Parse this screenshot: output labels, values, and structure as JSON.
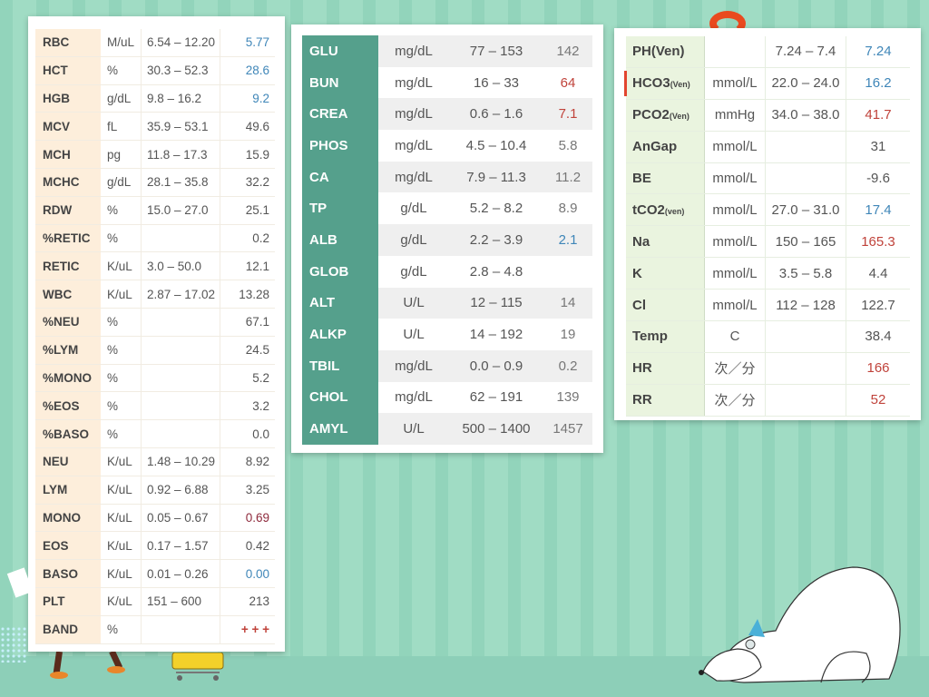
{
  "colors": {
    "red": "#c0433b",
    "blue": "#3f86b8",
    "maroon": "#8e2a3c"
  },
  "cbc": [
    {
      "name": "RBC",
      "unit": "M/uL",
      "range": "6.54 – 12.20",
      "value": "5.77",
      "flag": "blue"
    },
    {
      "name": "HCT",
      "unit": "%",
      "range": "30.3 – 52.3",
      "value": "28.6",
      "flag": "blue"
    },
    {
      "name": "HGB",
      "unit": "g/dL",
      "range": "9.8 – 16.2",
      "value": "9.2",
      "flag": "blue"
    },
    {
      "name": "MCV",
      "unit": "fL",
      "range": "35.9 – 53.1",
      "value": "49.6",
      "flag": ""
    },
    {
      "name": "MCH",
      "unit": "pg",
      "range": "11.8 – 17.3",
      "value": "15.9",
      "flag": ""
    },
    {
      "name": "MCHC",
      "unit": "g/dL",
      "range": "28.1 – 35.8",
      "value": "32.2",
      "flag": ""
    },
    {
      "name": "RDW",
      "unit": "%",
      "range": "15.0 – 27.0",
      "value": "25.1",
      "flag": ""
    },
    {
      "name": "%RETIC",
      "unit": "%",
      "range": "",
      "value": "0.2",
      "flag": ""
    },
    {
      "name": "RETIC",
      "unit": "K/uL",
      "range": "3.0 – 50.0",
      "value": "12.1",
      "flag": ""
    },
    {
      "name": "WBC",
      "unit": "K/uL",
      "range": "2.87 – 17.02",
      "value": "13.28",
      "flag": ""
    },
    {
      "name": "%NEU",
      "unit": "%",
      "range": "",
      "value": "67.1",
      "flag": ""
    },
    {
      "name": "%LYM",
      "unit": "%",
      "range": "",
      "value": "24.5",
      "flag": ""
    },
    {
      "name": "%MONO",
      "unit": "%",
      "range": "",
      "value": "5.2",
      "flag": ""
    },
    {
      "name": "%EOS",
      "unit": "%",
      "range": "",
      "value": "3.2",
      "flag": ""
    },
    {
      "name": "%BASO",
      "unit": "%",
      "range": "",
      "value": "0.0",
      "flag": ""
    },
    {
      "name": "NEU",
      "unit": "K/uL",
      "range": "1.48 – 10.29",
      "value": "8.92",
      "flag": ""
    },
    {
      "name": "LYM",
      "unit": "K/uL",
      "range": "0.92 – 6.88",
      "value": "3.25",
      "flag": ""
    },
    {
      "name": "MONO",
      "unit": "K/uL",
      "range": "0.05 – 0.67",
      "value": "0.69",
      "flag": "maroon"
    },
    {
      "name": "EOS",
      "unit": "K/uL",
      "range": "0.17 – 1.57",
      "value": "0.42",
      "flag": ""
    },
    {
      "name": "BASO",
      "unit": "K/uL",
      "range": "0.01 – 0.26",
      "value": "0.00",
      "flag": "blue"
    },
    {
      "name": "PLT",
      "unit": "K/uL",
      "range": "151 – 600",
      "value": "213",
      "flag": ""
    },
    {
      "name": "BAND",
      "unit": "%",
      "range": "",
      "value": "+ + +",
      "flag": "red"
    }
  ],
  "chem": [
    {
      "name": "GLU",
      "unit": "mg/dL",
      "range": "77 – 153",
      "value": "142",
      "flag": ""
    },
    {
      "name": "BUN",
      "unit": "mg/dL",
      "range": "16 – 33",
      "value": "64",
      "flag": "red"
    },
    {
      "name": "CREA",
      "unit": "mg/dL",
      "range": "0.6 – 1.6",
      "value": "7.1",
      "flag": "red"
    },
    {
      "name": "PHOS",
      "unit": "mg/dL",
      "range": "4.5 – 10.4",
      "value": "5.8",
      "flag": ""
    },
    {
      "name": "CA",
      "unit": "mg/dL",
      "range": "7.9 – 11.3",
      "value": "11.2",
      "flag": ""
    },
    {
      "name": "TP",
      "unit": "g/dL",
      "range": "5.2 – 8.2",
      "value": "8.9",
      "flag": ""
    },
    {
      "name": "ALB",
      "unit": "g/dL",
      "range": "2.2 – 3.9",
      "value": "2.1",
      "flag": "blue"
    },
    {
      "name": "GLOB",
      "unit": "g/dL",
      "range": "2.8 – 4.8",
      "value": "",
      "flag": ""
    },
    {
      "name": "ALT",
      "unit": "U/L",
      "range": "12 – 115",
      "value": "14",
      "flag": ""
    },
    {
      "name": "ALKP",
      "unit": "U/L",
      "range": "14 – 192",
      "value": "19",
      "flag": ""
    },
    {
      "name": "TBIL",
      "unit": "mg/dL",
      "range": "0.0 – 0.9",
      "value": "0.2",
      "flag": ""
    },
    {
      "name": "CHOL",
      "unit": "mg/dL",
      "range": "62 – 191",
      "value": "139",
      "flag": ""
    },
    {
      "name": "AMYL",
      "unit": "U/L",
      "range": "500 – 1400",
      "value": "1457",
      "flag": ""
    }
  ],
  "gas": [
    {
      "name": "PH(Ven)",
      "sub": "",
      "unit": "",
      "range": "7.24 – 7.4",
      "value": "7.24",
      "flag": "blue"
    },
    {
      "name": "HCO3",
      "sub": "(Ven)",
      "unit": "mmol/L",
      "range": "22.0 – 24.0",
      "value": "16.2",
      "flag": "blue"
    },
    {
      "name": "PCO2",
      "sub": "(Ven)",
      "unit": "mmHg",
      "range": "34.0 – 38.0",
      "value": "41.7",
      "flag": "red"
    },
    {
      "name": "AnGap",
      "sub": "",
      "unit": "mmol/L",
      "range": "",
      "value": "31",
      "flag": ""
    },
    {
      "name": "BE",
      "sub": "",
      "unit": "mmol/L",
      "range": "",
      "value": "-9.6",
      "flag": ""
    },
    {
      "name": "tCO2",
      "sub": "(ven)",
      "unit": "mmol/L",
      "range": "27.0 – 31.0",
      "value": "17.4",
      "flag": "blue"
    },
    {
      "name": "Na",
      "sub": "",
      "unit": "mmol/L",
      "range": "150 – 165",
      "value": "165.3",
      "flag": "red"
    },
    {
      "name": "K",
      "sub": "",
      "unit": "mmol/L",
      "range": "3.5 – 5.8",
      "value": "4.4",
      "flag": ""
    },
    {
      "name": "Cl",
      "sub": "",
      "unit": "mmol/L",
      "range": "112 – 128",
      "value": "122.7",
      "flag": ""
    },
    {
      "name": "Temp",
      "sub": "",
      "unit": "C",
      "range": "",
      "value": "38.4",
      "flag": ""
    },
    {
      "name": "HR",
      "sub": "",
      "unit": "次／分",
      "range": "",
      "value": "166",
      "flag": "red"
    },
    {
      "name": "RR",
      "sub": "",
      "unit": "次／分",
      "range": "",
      "value": "52",
      "flag": "red"
    }
  ]
}
